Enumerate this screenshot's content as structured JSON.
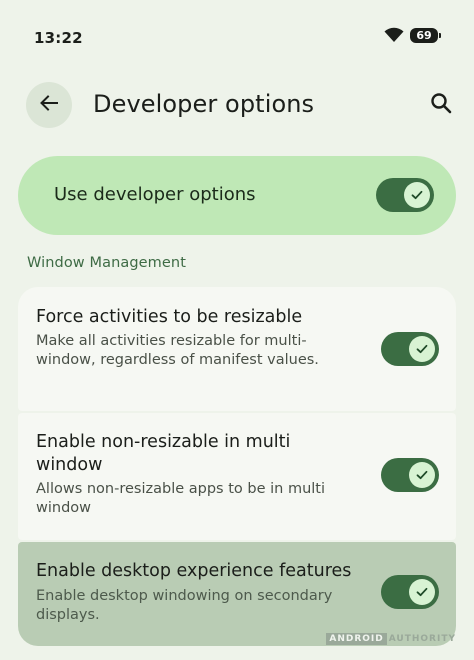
{
  "status_bar": {
    "time": "13:22",
    "battery": "69"
  },
  "app_bar": {
    "title": "Developer options"
  },
  "master_toggle": {
    "label": "Use developer options",
    "enabled": true
  },
  "section": {
    "header": "Window Management"
  },
  "settings": [
    {
      "title": "Force activities to be resizable",
      "summary": "Make all activities resizable for multi-window, regardless of manifest values.",
      "enabled": true
    },
    {
      "title": "Enable non-resizable in multi window",
      "summary": "Allows non-resizable apps to be in multi window",
      "enabled": true
    },
    {
      "title": "Enable desktop experience features",
      "summary": "Enable desktop windowing on secondary displays.",
      "enabled": true
    }
  ],
  "watermark": {
    "box": "ANDROID",
    "text": "AUTHORITY"
  },
  "colors": {
    "background": "#eef3ea",
    "master_card": "#bfe8b6",
    "switch_track": "#3b6d43",
    "switch_thumb": "#d8f3d3",
    "section_header": "#3e6b45",
    "highlighted_card": "#b9ccb4"
  }
}
